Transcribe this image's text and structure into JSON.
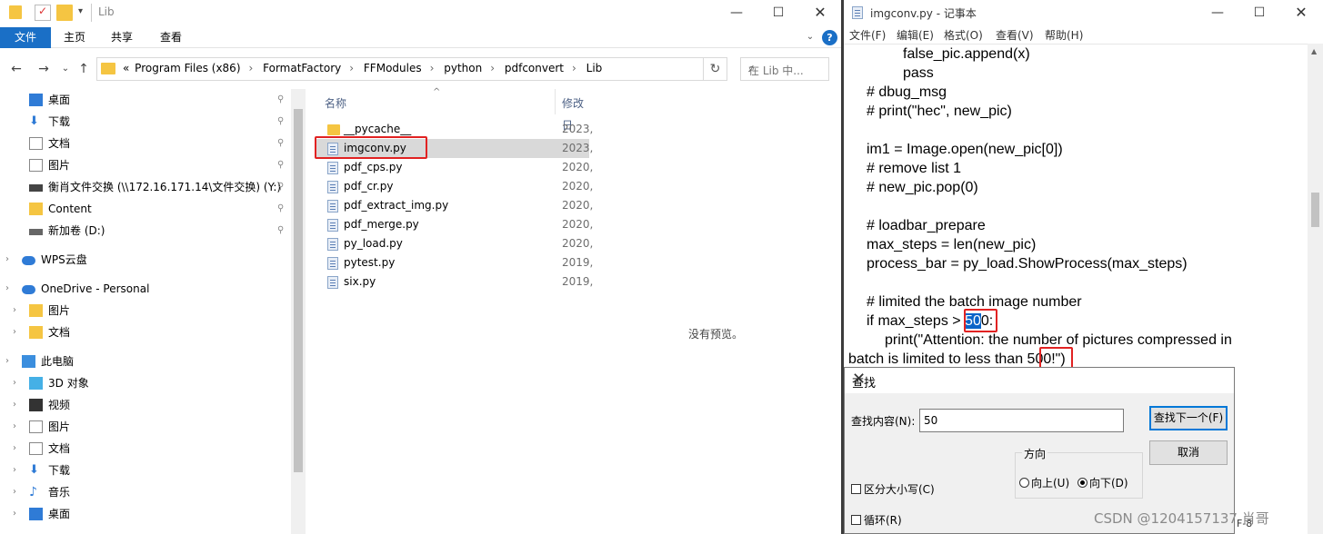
{
  "explorer": {
    "window_title": "Lib",
    "ribbon_tabs": [
      "文件",
      "主页",
      "共享",
      "查看"
    ],
    "breadcrumbs": [
      "Program Files (x86)",
      "FormatFactory",
      "FFModules",
      "python",
      "pdfconvert",
      "Lib"
    ],
    "breadcrumb_prefix": "«",
    "search_placeholder": "在 Lib 中...",
    "nav_items": [
      {
        "label": "桌面",
        "icon": "desktop-icon",
        "pinned": true
      },
      {
        "label": "下载",
        "icon": "download-icon",
        "pinned": true
      },
      {
        "label": "文档",
        "icon": "document-icon",
        "pinned": true
      },
      {
        "label": "图片",
        "icon": "picture-icon",
        "pinned": true
      },
      {
        "label": "衡肖文件交换 (\\\\172.16.171.14\\文件交换) (Y:)",
        "icon": "network-drive-icon",
        "pinned": true
      },
      {
        "label": "Content",
        "icon": "folder-icon",
        "pinned": true
      },
      {
        "label": "新加卷 (D:)",
        "icon": "drive-icon",
        "pinned": true
      },
      {
        "label": "WPS云盘",
        "icon": "cloud-icon"
      },
      {
        "label": "OneDrive - Personal",
        "icon": "cloud-icon"
      },
      {
        "label": "图片",
        "icon": "folder-icon"
      },
      {
        "label": "文档",
        "icon": "folder-icon"
      },
      {
        "label": "此电脑",
        "icon": "computer-icon"
      },
      {
        "label": "3D 对象",
        "icon": "3d-objects-icon"
      },
      {
        "label": "视频",
        "icon": "video-icon"
      },
      {
        "label": "图片",
        "icon": "picture-icon"
      },
      {
        "label": "文档",
        "icon": "document-icon"
      },
      {
        "label": "下载",
        "icon": "download-icon"
      },
      {
        "label": "音乐",
        "icon": "music-icon"
      },
      {
        "label": "桌面",
        "icon": "desktop-icon"
      }
    ],
    "columns": {
      "name": "名称",
      "modified": "修改日"
    },
    "files": [
      {
        "name": "__pycache__",
        "date": "2023,",
        "type": "folder"
      },
      {
        "name": "imgconv.py",
        "date": "2023,",
        "type": "py",
        "selected": true
      },
      {
        "name": "pdf_cps.py",
        "date": "2020,",
        "type": "py"
      },
      {
        "name": "pdf_cr.py",
        "date": "2020,",
        "type": "py"
      },
      {
        "name": "pdf_extract_img.py",
        "date": "2020,",
        "type": "py"
      },
      {
        "name": "pdf_merge.py",
        "date": "2020,",
        "type": "py"
      },
      {
        "name": "py_load.py",
        "date": "2020,",
        "type": "py"
      },
      {
        "name": "pytest.py",
        "date": "2019,",
        "type": "py"
      },
      {
        "name": "six.py",
        "date": "2019,",
        "type": "py"
      }
    ],
    "preview_text": "没有预览。"
  },
  "notepad": {
    "title": "imgconv.py - 记事本",
    "menu": [
      "文件(F)",
      "编辑(E)",
      "格式(O)",
      "查看(V)",
      "帮助(H)"
    ],
    "code_lines": [
      {
        "indent": 60,
        "pre": "false_pic.append(x)"
      },
      {
        "indent": 60,
        "pre": "pass"
      },
      {
        "indent": 20,
        "pre": "# dbug_msg"
      },
      {
        "indent": 20,
        "pre": "# print(\"hec\", new_pic)"
      },
      {
        "indent": 20,
        "pre": ""
      },
      {
        "indent": 20,
        "pre": "im1 = Image.open(new_pic[0])"
      },
      {
        "indent": 20,
        "pre": "# remove list 1"
      },
      {
        "indent": 20,
        "pre": "# new_pic.pop(0)"
      },
      {
        "indent": 20,
        "pre": ""
      },
      {
        "indent": 20,
        "pre": "# loadbar_prepare"
      },
      {
        "indent": 20,
        "pre": "max_steps = len(new_pic)"
      },
      {
        "indent": 20,
        "pre": "process_bar = py_load.ShowProcess(max_steps)"
      },
      {
        "indent": 20,
        "pre": ""
      },
      {
        "indent": 20,
        "pre": "# limited the batch image number"
      },
      {
        "indent": 20,
        "pre": "if max_steps > ",
        "hl": "50",
        "post": "0:"
      },
      {
        "indent": 40,
        "pre": "print(\"Attention: the number of pictures compressed in"
      },
      {
        "indent": 0,
        "pre": "batch is limited to less than 500!\")"
      }
    ],
    "status_partial": "F-8"
  },
  "find_dialog": {
    "title": "查找",
    "find_label": "查找内容(N):",
    "find_value": "50",
    "find_next_label": "查找下一个(F)",
    "cancel_label": "取消",
    "direction_label": "方向",
    "up_label": "向上(U)",
    "down_label": "向下(D)",
    "match_case_label": "区分大小写(C)",
    "wrap_label": "循环(R)"
  },
  "watermark": "CSDN @1204157137 肖哥"
}
